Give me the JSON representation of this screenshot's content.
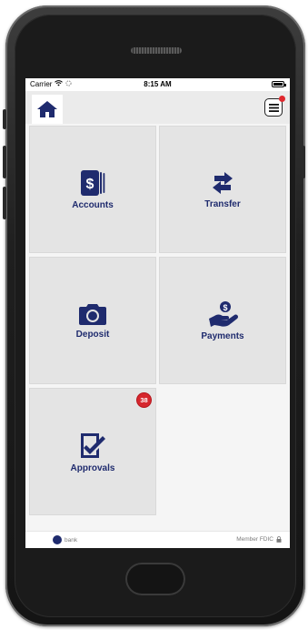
{
  "status_bar": {
    "carrier": "Carrier",
    "time": "8:15 AM"
  },
  "tiles": [
    {
      "label": "Accounts",
      "icon": "dollar-card-icon"
    },
    {
      "label": "Transfer",
      "icon": "transfer-arrows-icon"
    },
    {
      "label": "Deposit",
      "icon": "camera-icon"
    },
    {
      "label": "Payments",
      "icon": "hand-coin-icon"
    },
    {
      "label": "Approvals",
      "icon": "checklist-icon",
      "badge": "38"
    }
  ],
  "footer": {
    "brand": "bank",
    "member_text": "Member FDIC"
  },
  "colors": {
    "brand": "#1f2b6e",
    "badge": "#d6262d",
    "tile_bg": "#e4e4e4"
  }
}
